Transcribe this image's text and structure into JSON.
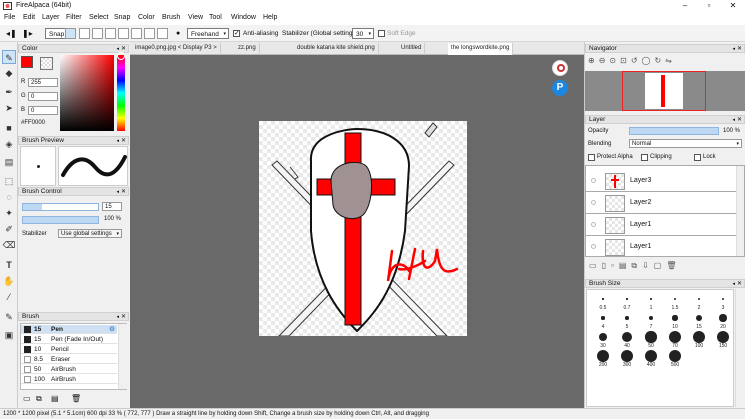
{
  "window": {
    "title": "FireAlpaca (64bit)",
    "minimize": "–",
    "maximize": "▫",
    "close": "✕"
  },
  "menu": [
    "File",
    "Edit",
    "Layer",
    "Filter",
    "Select",
    "Snap",
    "Color",
    "Brush",
    "View",
    "Tool",
    "Window",
    "Help"
  ],
  "toolbar": {
    "snap_label": "Snap",
    "freehand": "Freehand",
    "antialias_label": "Anti-aliasing",
    "antialias_checked": true,
    "stabilizer_label": "Stabilizer (Global settings)",
    "stabilizer_value": "30",
    "soft_edge_label": "Soft Edge",
    "soft_edge_checked": false
  },
  "tabs": [
    "image0.png.jpg < Display P3 >",
    "zz.png",
    "double katana kite shield.png",
    "Untitled",
    "the longswordkite.png"
  ],
  "active_tab": 4,
  "color_panel": {
    "title": "Color",
    "r_label": "R",
    "r": "255",
    "g_label": "G",
    "g": "0",
    "b_label": "B",
    "b": "0",
    "hex": "#FF0000",
    "fg": "#ff0000",
    "bg": "#ffffff"
  },
  "brush_preview": {
    "title": "Brush Preview"
  },
  "brush_control": {
    "title": "Brush Control",
    "size": "15",
    "opacity": "100 %",
    "size_fill": 0.25,
    "opacity_fill": 1.0,
    "stabilizer_label": "Stabilizer",
    "stabilizer_value": "Use global settings"
  },
  "brush_panel": {
    "title": "Brush",
    "items": [
      {
        "size": "15",
        "name": "Pen",
        "selected": true
      },
      {
        "size": "15",
        "name": "Pen (Fade In/Out)",
        "selected": false
      },
      {
        "size": "10",
        "name": "Pencil",
        "selected": false
      },
      {
        "size": "8.5",
        "name": "Eraser",
        "selected": false
      },
      {
        "size": "50",
        "name": "AirBrush",
        "selected": false
      },
      {
        "size": "100",
        "name": "AirBrush",
        "selected": false
      }
    ]
  },
  "navigator": {
    "title": "Navigator"
  },
  "layer_panel": {
    "title": "Layer",
    "opacity_label": "Opacity",
    "opacity": "100 %",
    "blending_label": "Blending",
    "blending": "Normal",
    "protect_alpha": "Protect Alpha",
    "clipping": "Clipping",
    "lock": "Lock",
    "layers": [
      "Layer3",
      "Layer2",
      "Layer1",
      "Layer1"
    ]
  },
  "brush_size_panel": {
    "title": "Brush Size",
    "sizes": [
      "0.5",
      "0.7",
      "1",
      "1.5",
      "2",
      "3",
      "4",
      "5",
      "7",
      "10",
      "15",
      "20",
      "30",
      "40",
      "50",
      "70",
      "100",
      "150",
      "200",
      "300",
      "400",
      "500"
    ]
  },
  "status": {
    "text": "1200 * 1200 pixel   (5.1 * 5.1cm)   600 dpi   33 %   ( 772, 777 )   Draw a straight line by holding down Shift, Change a brush size by holding down Ctrl, Alt, and dragging"
  },
  "colors": {
    "accent": "#3c8be0",
    "canvas_bg": "#696969",
    "red": "#ff0000"
  }
}
